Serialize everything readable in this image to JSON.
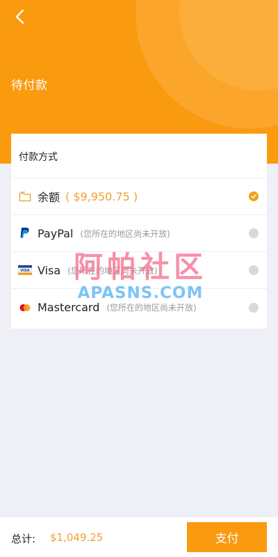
{
  "header": {
    "title": "待付款",
    "back_icon": "chevron-left-icon",
    "accent_color": "#f99a0f"
  },
  "payment": {
    "section_title": "付款方式",
    "methods": [
      {
        "icon": "wallet-icon",
        "label": "余额",
        "amount": "( $9,950.75 )",
        "note": "",
        "selected": true
      },
      {
        "icon": "paypal-icon",
        "label": "PayPal",
        "note": "(您所在的地区尚未开放)",
        "selected": false
      },
      {
        "icon": "visa-card-icon",
        "label": "Visa",
        "note": "(您所在的地区尚未开放)",
        "selected": false
      },
      {
        "icon": "mastercard-icon",
        "label": "Mastercard",
        "note": "(您所在的地区尚未开放)",
        "selected": false
      }
    ]
  },
  "watermark": {
    "cn": "阿帕社区",
    "en": "APASNS.COM"
  },
  "footer": {
    "total_label": "总计:",
    "total_amount": "$1,049.25",
    "pay_label": "支付"
  }
}
